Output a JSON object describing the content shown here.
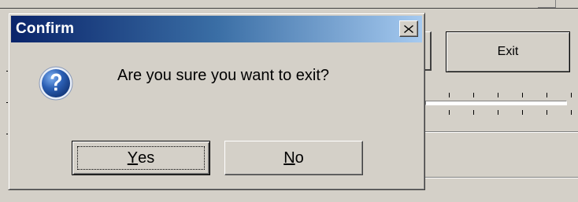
{
  "dialog": {
    "title": "Confirm",
    "message": "Are you sure you want to exit?",
    "icon": "question-icon",
    "buttons": {
      "yes": {
        "mnemonic": "Y",
        "rest": "es"
      },
      "no": {
        "mnemonic": "N",
        "rest": "o"
      }
    },
    "titlebar_gradient": [
      "#0a246a",
      "#a6caf0"
    ]
  },
  "background_window": {
    "exit_label": "Exit"
  },
  "colors": {
    "face": "#d4d0c8",
    "title_text": "#ffffff",
    "icon_blue": "#2b5fb4"
  }
}
